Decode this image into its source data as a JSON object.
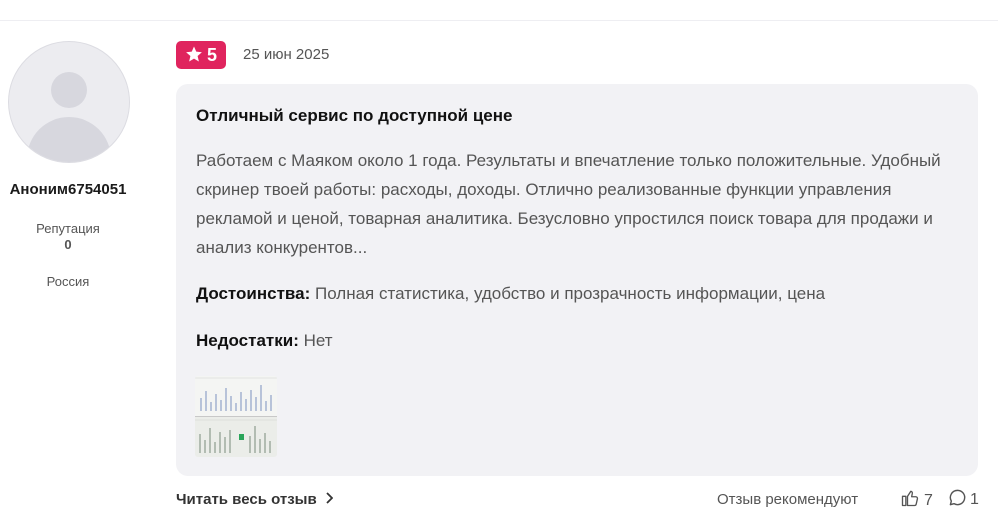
{
  "author": {
    "name": "Аноним6754051",
    "reputation_label": "Репутация",
    "reputation_value": "0",
    "country": "Россия"
  },
  "review": {
    "rating": "5",
    "date": "25 июн 2025",
    "title": "Отличный сервис по доступной цене",
    "text": "Работаем с Маяком около 1 года. Результаты и впечатление только положительные. Удобный скринер твоей работы: расходы, доходы. Отлично реализованные функции управления рекламой и ценой, товарная аналитика. Безусловно упростился поиск товара для продажи и анализ конкурентов...",
    "pros_label": "Достоинства:",
    "pros": "Полная статистика, удобство и прозрачность информации, цена",
    "cons_label": "Недостатки:",
    "cons": "Нет"
  },
  "footer": {
    "read_all": "Читать весь отзыв",
    "recommend_label": "Отзыв рекомендуют",
    "likes": "7",
    "comments": "1"
  },
  "colors": {
    "accent": "#e0245e",
    "card_bg": "#f2f2f5"
  },
  "icons": {
    "rating": "star-icon",
    "read_all": "chevron-right-icon",
    "likes": "thumbs-up-icon",
    "comments": "comment-icon"
  }
}
